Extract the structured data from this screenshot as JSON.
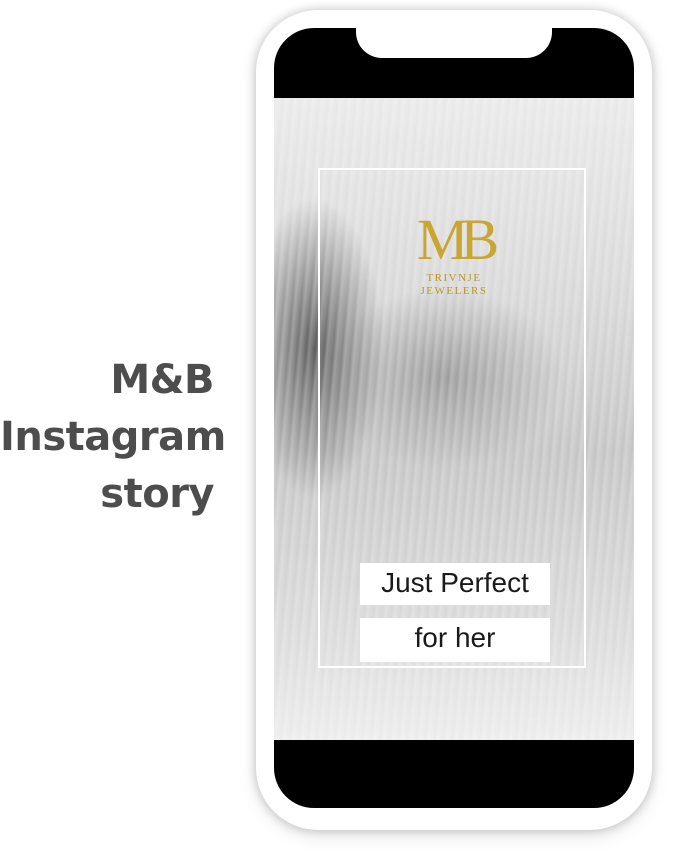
{
  "caption": {
    "line1": "M&B",
    "line2": "Instagram",
    "line3": "story"
  },
  "story": {
    "logo": {
      "mark": "MB",
      "line1": "TRIVNJE",
      "line2": "JEWELERS"
    },
    "text_line1": "Just Perfect",
    "text_line2": "for her"
  },
  "colors": {
    "gold": "#c9a533",
    "caption": "#4d4d4d",
    "screen_bg": "#000000"
  }
}
